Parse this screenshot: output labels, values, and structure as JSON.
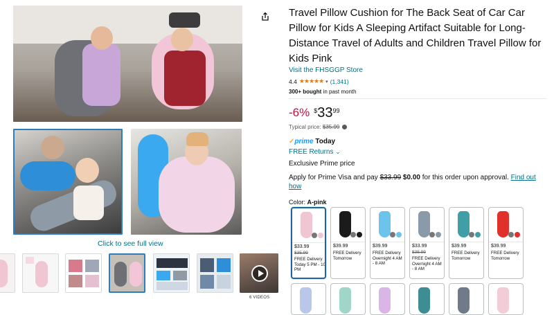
{
  "product": {
    "title": "Travel Pillow Cushion for The Back Seat of Car Car Pillow for Kids A Sleeping Artifact Suitable for Long-Distance Travel of Adults and Children Travel Pillow for Kids Pink",
    "store_link": "Visit the FHSGGP Store",
    "rating": "4.4",
    "stars": "★★★★★",
    "review_count": "(1,341)",
    "bought_bold": "300+ bought",
    "bought_rest": " in past month"
  },
  "price": {
    "discount": "-6%",
    "currency": "$",
    "whole": "33",
    "fraction": "99",
    "typical_label": "Typical price: ",
    "typical_value": "$35.99"
  },
  "delivery": {
    "prime_check": "✓",
    "prime_word": "prime",
    "prime_today": " Today",
    "free_returns": "FREE Returns",
    "exclusive": "Exclusive Prime price",
    "visa_text_1": "Apply for Prime Visa and pay ",
    "visa_strike": "$33.99",
    "visa_bold": " $0.00",
    "visa_text_2": " for this order upon approval. ",
    "visa_link": "Find out how"
  },
  "color": {
    "label": "Color: ",
    "selected": "A-pink"
  },
  "gallery": {
    "see_full": "Click to see full view",
    "videos_label": "6 VIDEOS"
  },
  "swatches": [
    {
      "price": "$33.99",
      "strike": "$35.99",
      "delivery": "FREE Delivery Today 5 PM - 10 PM",
      "color": "#f1c6d3"
    },
    {
      "price": "$39.99",
      "strike": "",
      "delivery": "FREE Delivery Tomorrow",
      "color": "#1b1b1b"
    },
    {
      "price": "$39.99",
      "strike": "",
      "delivery": "FREE Delivery Overnight 4 AM - 8 AM",
      "color": "#6cc3ec"
    },
    {
      "price": "$33.99",
      "strike": "$35.99",
      "delivery": "FREE Delivery Overnight 4 AM - 8 AM",
      "color": "#8a9aa8"
    },
    {
      "price": "$39.99",
      "strike": "",
      "delivery": "FREE Delivery Tomorrow",
      "color": "#3f9ea6"
    },
    {
      "price": "$39.99",
      "strike": "",
      "delivery": "FREE Delivery Tomorrow",
      "color": "#e0312b"
    }
  ],
  "swatches_row2_colors": [
    "#b9c8ea",
    "#9fd6c8",
    "#d9b6e6",
    "#3d8d92",
    "#707b8a",
    "#f3cdd6"
  ]
}
